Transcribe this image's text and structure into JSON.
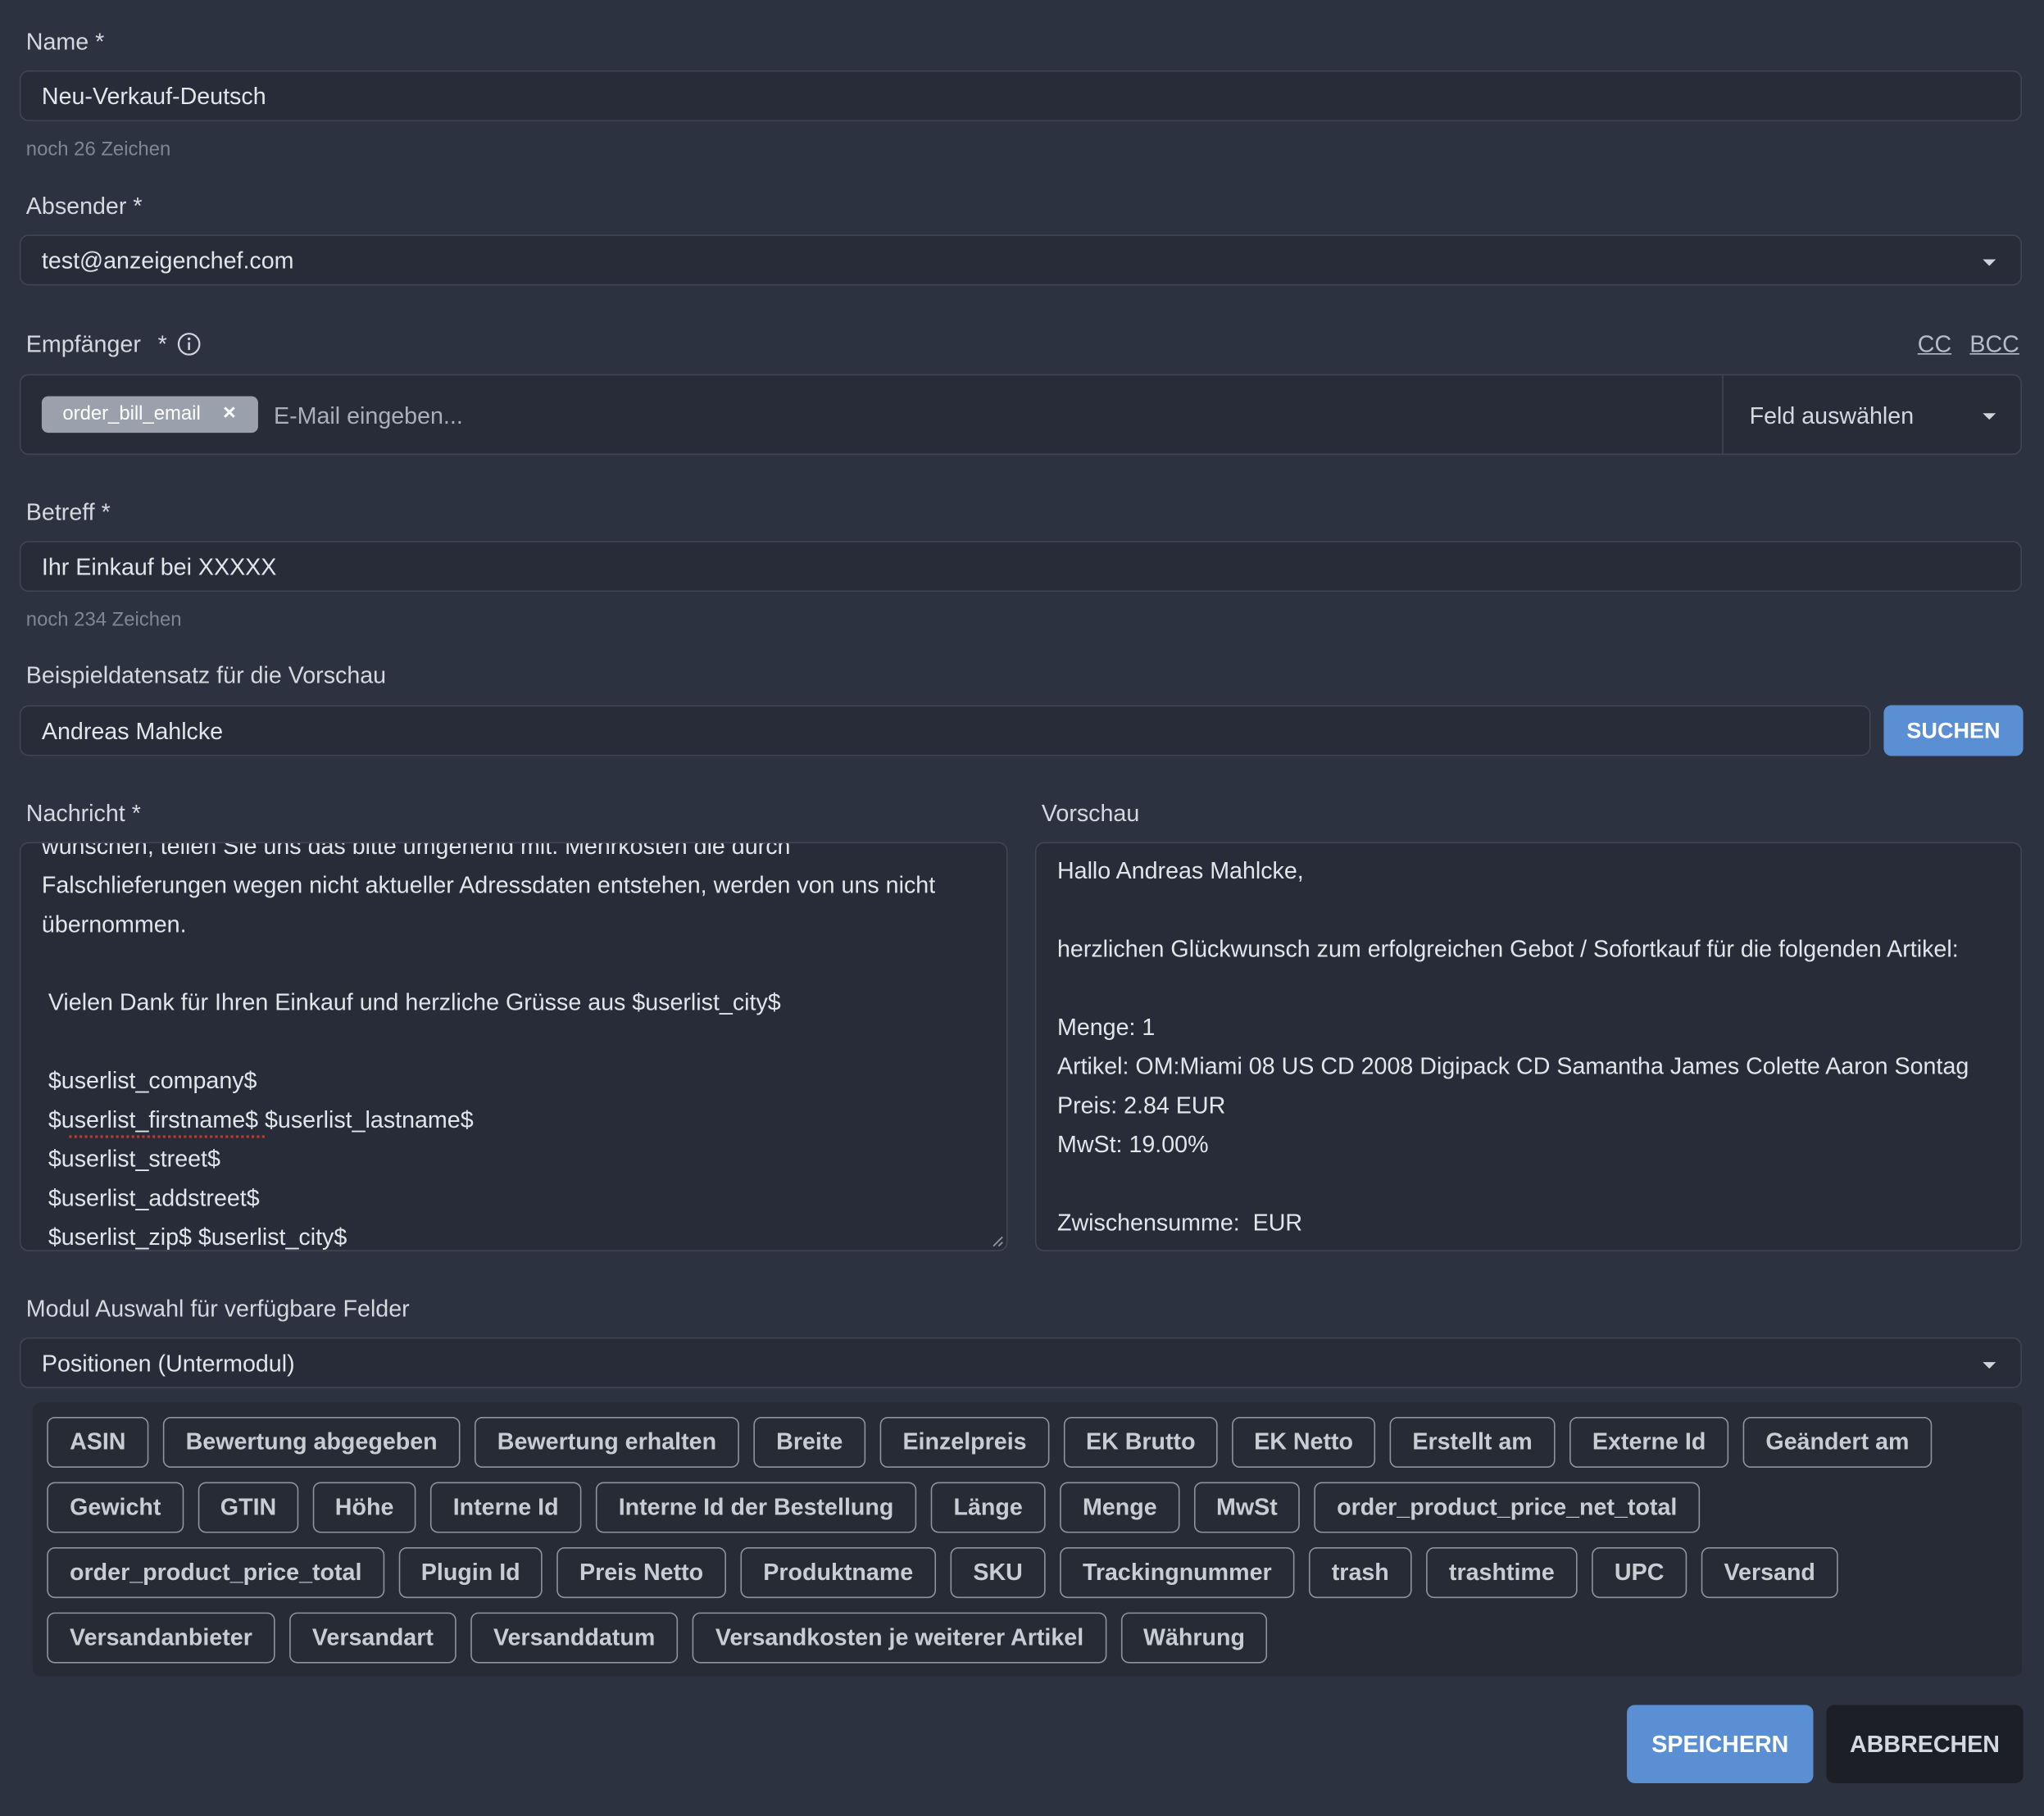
{
  "name": {
    "label": "Name *",
    "value": "Neu-Verkauf-Deutsch",
    "hint": "noch 26 Zeichen"
  },
  "sender": {
    "label": "Absender *",
    "value": "test@anzeigenchef.com"
  },
  "recipient": {
    "label": "Empfänger",
    "required": "*",
    "cc_label": "CC",
    "bcc_label": "BCC",
    "chip": "order_bill_email",
    "chip_remove": "×",
    "input_placeholder": "E-Mail eingeben...",
    "field_select": "Feld auswählen"
  },
  "subject": {
    "label": "Betreff *",
    "value": "Ihr Einkauf bei XXXXX",
    "hint": "noch 234 Zeichen"
  },
  "preview_record": {
    "label": "Beispieldatensatz für die Vorschau",
    "value": "Andreas Mahlcke",
    "search_button": "SUCHEN"
  },
  "message": {
    "label": "Nachricht *",
    "lines": [
      "wünschen, teilen Sie uns das bitte umgehend mit. Mehrkosten die durch",
      "Falschlieferungen wegen nicht aktueller Adressdaten entstehen, werden von uns nicht",
      "übernommen.",
      "",
      " Vielen Dank für Ihren Einkauf und herzliche Grüsse aus $userlist_city$",
      "",
      " $userlist_company$",
      " $userlist_firstname$ $userlist_lastname$",
      " $userlist_street$",
      " $userlist_addstreet$",
      " $userlist_zip$ $userlist_city$"
    ]
  },
  "preview": {
    "label": "Vorschau",
    "lines": [
      "Hallo Andreas Mahlcke,",
      "",
      "herzlichen Glückwunsch zum erfolgreichen Gebot / Sofortkauf für die folgenden Artikel:",
      "",
      "Menge: 1",
      "Artikel: OM:Miami 08 US CD 2008 Digipack CD Samantha James Colette Aaron Sontag",
      "Preis: 2.84 EUR",
      "MwSt: 19.00%",
      "",
      "Zwischensumme:  EUR"
    ]
  },
  "module": {
    "label": "Modul Auswahl für verfügbare Felder",
    "value": "Positionen (Untermodul)"
  },
  "fields": [
    [
      "ASIN",
      "Bewertung abgegeben",
      "Bewertung erhalten",
      "Breite",
      "Einzelpreis",
      "EK Brutto",
      "EK Netto",
      "Erstellt am",
      "Externe Id",
      "Geändert am"
    ],
    [
      "Gewicht",
      "GTIN",
      "Höhe",
      "Interne Id",
      "Interne Id der Bestellung",
      "Länge",
      "Menge",
      "MwSt",
      "order_product_price_net_total"
    ],
    [
      "order_product_price_total",
      "Plugin Id",
      "Preis Netto",
      "Produktname",
      "SKU",
      "Trackingnummer",
      "trash",
      "trashtime",
      "UPC",
      "Versand"
    ],
    [
      "Versandanbieter",
      "Versandart",
      "Versanddatum",
      "Versandkosten je weiterer Artikel",
      "Währung"
    ]
  ],
  "actions": {
    "save": "SPEICHERN",
    "cancel": "ABBRECHEN"
  },
  "colors": {
    "background": "#2c3240",
    "input_bg": "#272c38",
    "primary": "#5b8fd4",
    "dark_button": "#1c1f26"
  }
}
